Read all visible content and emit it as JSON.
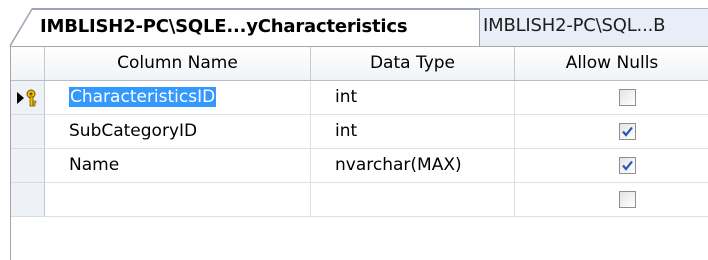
{
  "tabs": [
    {
      "label": "IMBLISH2-PC\\SQLE...yCharacteristics",
      "active": true
    },
    {
      "label": "IMBLISH2-PC\\SQL...B",
      "active": false
    }
  ],
  "grid": {
    "columns": {
      "name": "Column Name",
      "type": "Data Type",
      "nulls": "Allow Nulls"
    },
    "rows": [
      {
        "name": "CharacteristicsID",
        "type": "int",
        "allow_nulls": false,
        "current": true,
        "primary_key": true,
        "selected_text": true
      },
      {
        "name": "SubCategoryID",
        "type": "int",
        "allow_nulls": true
      },
      {
        "name": "Name",
        "type": "nvarchar(MAX)",
        "allow_nulls": true
      },
      {
        "name": "",
        "type": "",
        "allow_nulls": false
      }
    ]
  },
  "icons": {
    "row_marker": "current-row-arrow-icon",
    "key": "primary-key-icon"
  },
  "colors": {
    "selection": "#3399ff",
    "check": "#2a56b3"
  }
}
